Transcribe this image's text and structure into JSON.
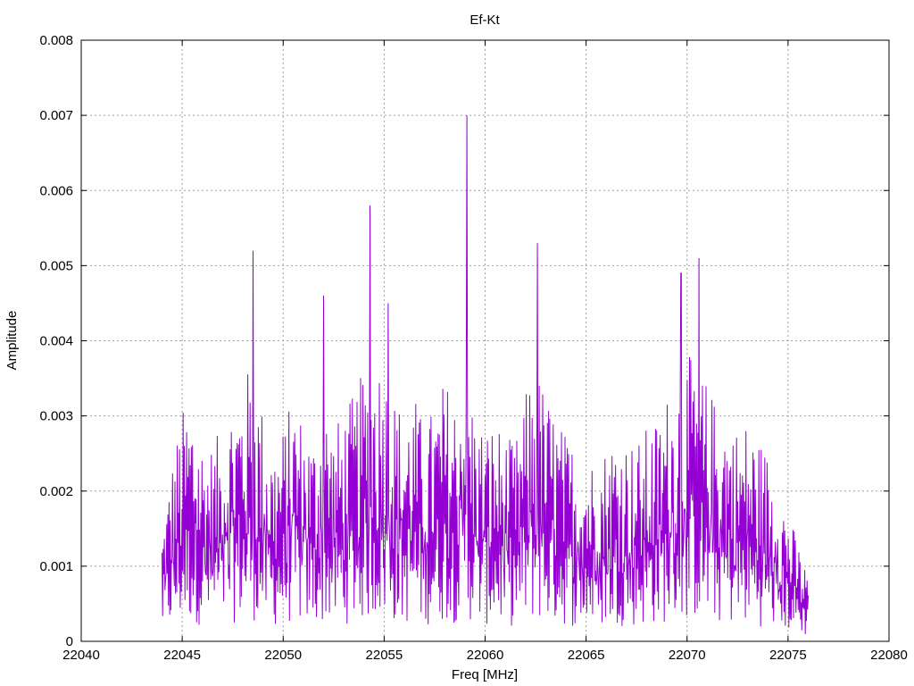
{
  "chart_data": {
    "type": "line",
    "title": "Ef-Kt",
    "xlabel": "Freq [MHz]",
    "ylabel": "Amplitude",
    "xlim": [
      22040,
      22080
    ],
    "ylim": [
      0,
      0.008
    ],
    "x_ticks": [
      "22040",
      "22045",
      "22050",
      "22055",
      "22060",
      "22065",
      "22070",
      "22075",
      "22080"
    ],
    "y_ticks": [
      "0",
      "0.001",
      "0.002",
      "0.003",
      "0.004",
      "0.005",
      "0.006",
      "0.007",
      "0.008"
    ],
    "x_tick_values": [
      22040,
      22045,
      22050,
      22055,
      22060,
      22065,
      22070,
      22075,
      22080
    ],
    "y_tick_values": [
      0,
      0.001,
      0.002,
      0.003,
      0.004,
      0.005,
      0.006,
      0.007,
      0.008
    ],
    "grid": true,
    "line_color": "#9400d3",
    "series": [
      {
        "x": [
          22044.0,
          22044.5,
          22045.0,
          22045.5,
          22046.0,
          22046.5,
          22047.0,
          22047.5,
          22048.0,
          22048.5,
          22049.0,
          22049.5,
          22050.0,
          22050.5,
          22051.0,
          22051.5,
          22052.0,
          22052.5,
          22053.0,
          22053.5,
          22054.0,
          22054.5,
          22055.0,
          22055.5,
          22056.0,
          22056.5,
          22057.0,
          22057.5,
          22058.0,
          22058.5,
          22059.0,
          22059.5,
          22060.0,
          22060.5,
          22061.0,
          22061.5,
          22062.0,
          22062.5,
          22063.0,
          22063.5,
          22064.0,
          22064.5,
          22065.0,
          22065.5,
          22066.0,
          22066.5,
          22067.0,
          22067.5,
          22068.0,
          22068.5,
          22069.0,
          22069.5,
          22070.0,
          22070.5,
          22071.0,
          22071.5,
          22072.0,
          22072.5,
          22073.0,
          22073.5,
          22074.0,
          22074.5,
          22075.0,
          22075.5,
          22076.0
        ],
        "values": [
          0.0014,
          0.0022,
          0.0028,
          0.003,
          0.0025,
          0.0024,
          0.0026,
          0.003,
          0.0032,
          0.0034,
          0.0028,
          0.0024,
          0.0026,
          0.003,
          0.0027,
          0.0025,
          0.003,
          0.0026,
          0.0028,
          0.003,
          0.0033,
          0.0036,
          0.0034,
          0.003,
          0.0028,
          0.003,
          0.0026,
          0.0029,
          0.0032,
          0.003,
          0.0036,
          0.0028,
          0.0026,
          0.0027,
          0.0025,
          0.0024,
          0.003,
          0.0034,
          0.003,
          0.0028,
          0.0025,
          0.0024,
          0.0023,
          0.0022,
          0.0024,
          0.0026,
          0.0025,
          0.0024,
          0.0026,
          0.0027,
          0.003,
          0.0033,
          0.0034,
          0.0036,
          0.0031,
          0.0029,
          0.0028,
          0.0026,
          0.0027,
          0.0025,
          0.0023,
          0.002,
          0.0016,
          0.0012,
          0.0008
        ],
        "peaks": [
          {
            "x": 22048.5,
            "y": 0.0052
          },
          {
            "x": 22054.3,
            "y": 0.0058
          },
          {
            "x": 22059.1,
            "y": 0.007
          },
          {
            "x": 22062.6,
            "y": 0.0053
          },
          {
            "x": 22070.6,
            "y": 0.0051
          },
          {
            "x": 22069.7,
            "y": 0.0049
          },
          {
            "x": 22052.0,
            "y": 0.0046
          },
          {
            "x": 22055.2,
            "y": 0.0045
          }
        ]
      }
    ]
  }
}
